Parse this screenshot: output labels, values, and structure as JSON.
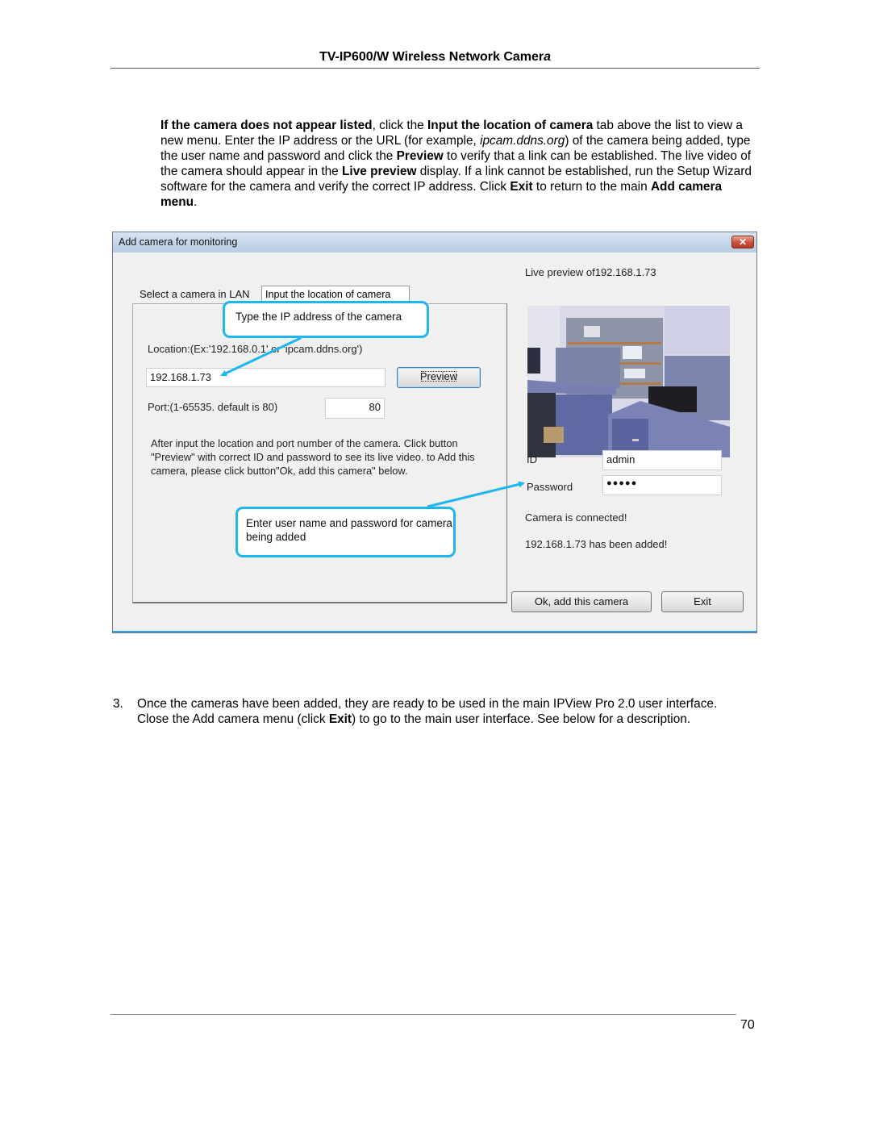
{
  "header": {
    "title_main": "TV-IP600/W Wireless Network Camer",
    "title_last_letter": "a"
  },
  "intro": {
    "p1_bold": "If the camera does not appear listed",
    "p2": ", click the ",
    "p3_bold": "Input the location of camera",
    "p4": " tab above the list to view a new menu. Enter the IP address or the URL (for example, ",
    "p5_italic": "ipcam.ddns.org",
    "p6": ") of the camera being added, type the user name and password and click the ",
    "p7_bold": "Preview",
    "p8": " to verify that a link can be established. The live video of the camera should appear in the ",
    "p9_bold": "Live preview",
    "p10": " display. If a link cannot be established, run the Setup Wizard software for the camera and verify the correct IP address. Click ",
    "p11_bold": "Exit",
    "p12": " to return to the main ",
    "p13_bold": "Add camera menu",
    "p14": "."
  },
  "dialog": {
    "title": "Add camera for monitoring",
    "close_glyph": "✕",
    "tabs": [
      {
        "label": "Select a camera in LAN",
        "active": false
      },
      {
        "label": "Input the location of camera",
        "active": true
      }
    ],
    "location_label": "Location:(Ex:'192.168.0.1' or 'ipcam.ddns.org')",
    "location_value": "192.168.1.73",
    "preview_button": "Preview",
    "port_label": "Port:(1-65535. default is 80)",
    "port_value": "80",
    "instructions": "After input the location and port number of the camera. Click button \"Preview\" with correct ID and password to see its live video. to Add this camera, please click button\"Ok, add this camera\" below.",
    "live_preview_label": "Live preview of192.168.1.73",
    "id_label": "ID",
    "id_value": "admin",
    "password_label": "Password",
    "password_value": "●●●●●",
    "status_connected": "Camera is connected!",
    "status_added": "192.168.1.73 has been added!",
    "ok_button": "Ok, add this camera",
    "exit_button": "Exit"
  },
  "callouts": {
    "ip_callout": "Type the IP address of the camera",
    "user_callout": "Enter user name and password for camera being added",
    "accent_color": "#1fb6ee"
  },
  "step3": {
    "number": "3.",
    "t1": "Once the cameras have been added, they are ready to be used in the main IPView Pro 2.0 user interface. Close the Add camera menu (click ",
    "t2_bold": "Exit",
    "t3": ") to go to the main user interface. See below for a description."
  },
  "footer": {
    "page_number": "70"
  }
}
